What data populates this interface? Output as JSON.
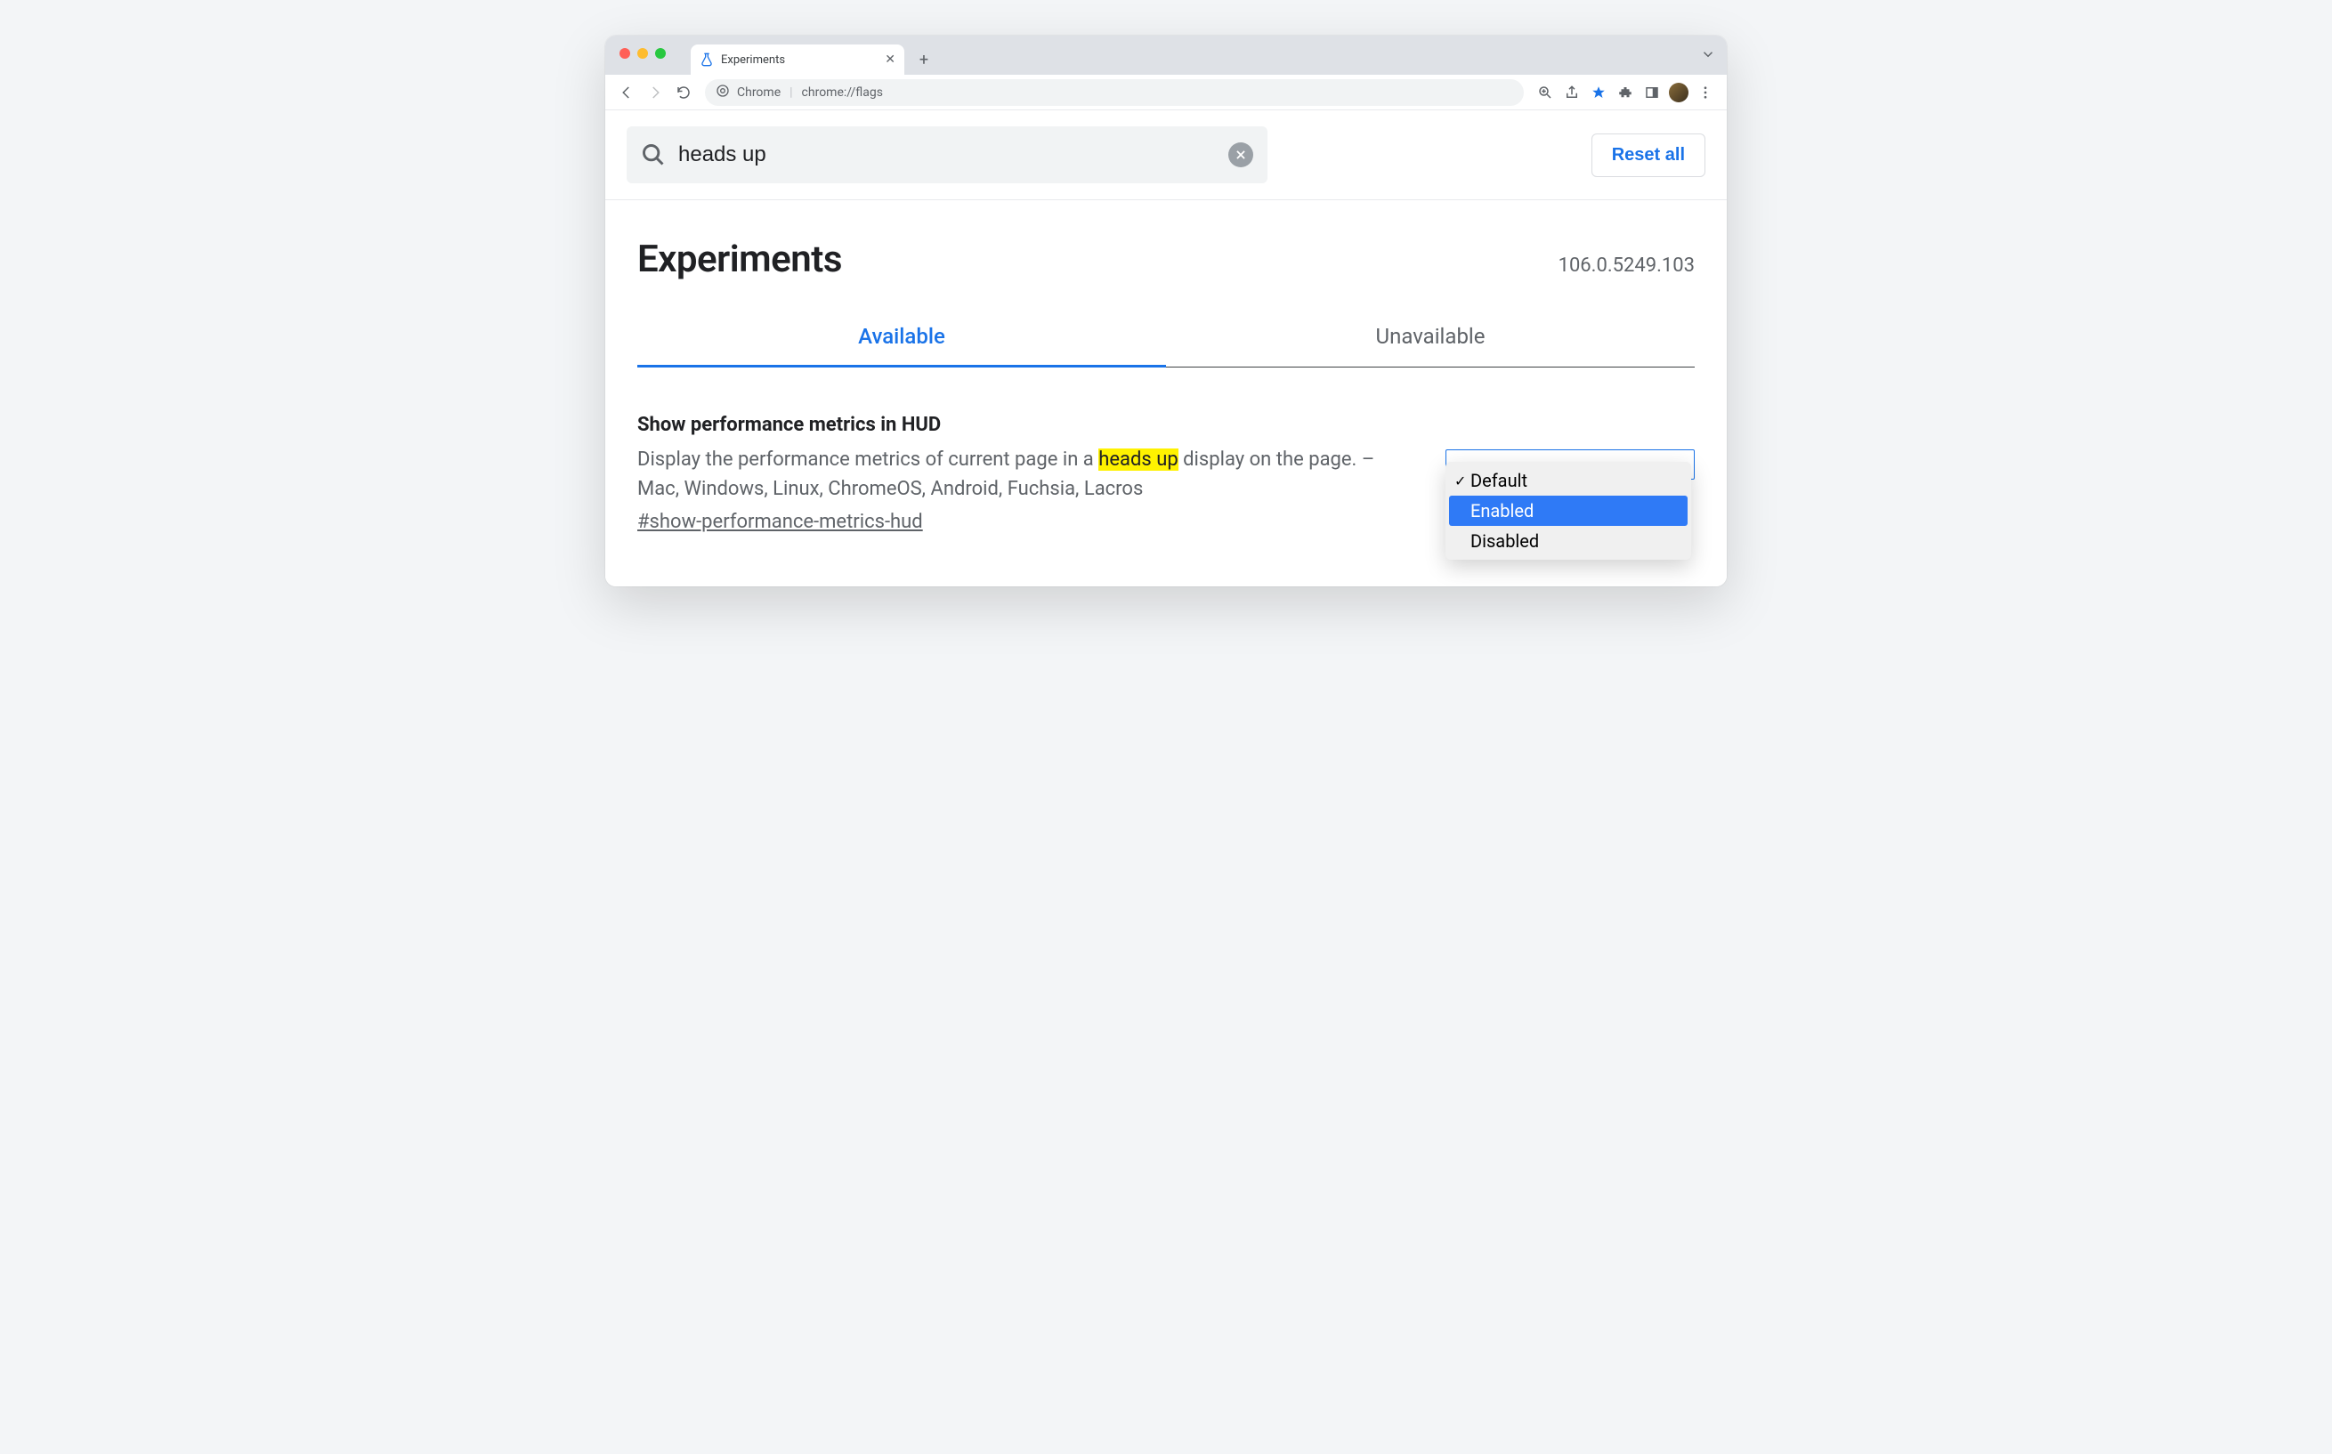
{
  "browser": {
    "tab_title": "Experiments",
    "omnibox_prefix": "Chrome",
    "omnibox_url": "chrome://flags"
  },
  "search": {
    "value": "heads up",
    "reset_all_label": "Reset all"
  },
  "header": {
    "title": "Experiments",
    "version": "106.0.5249.103"
  },
  "tabs": {
    "available": "Available",
    "unavailable": "Unavailable"
  },
  "flag": {
    "title": "Show performance metrics in HUD",
    "desc_before": "Display the performance metrics of current page in a ",
    "desc_highlight": "heads up",
    "desc_after": " display on the page. – Mac, Windows, Linux, ChromeOS, Android, Fuchsia, Lacros",
    "hash": "#show-performance-metrics-hud",
    "options": {
      "default": "Default",
      "enabled": "Enabled",
      "disabled": "Disabled"
    }
  }
}
